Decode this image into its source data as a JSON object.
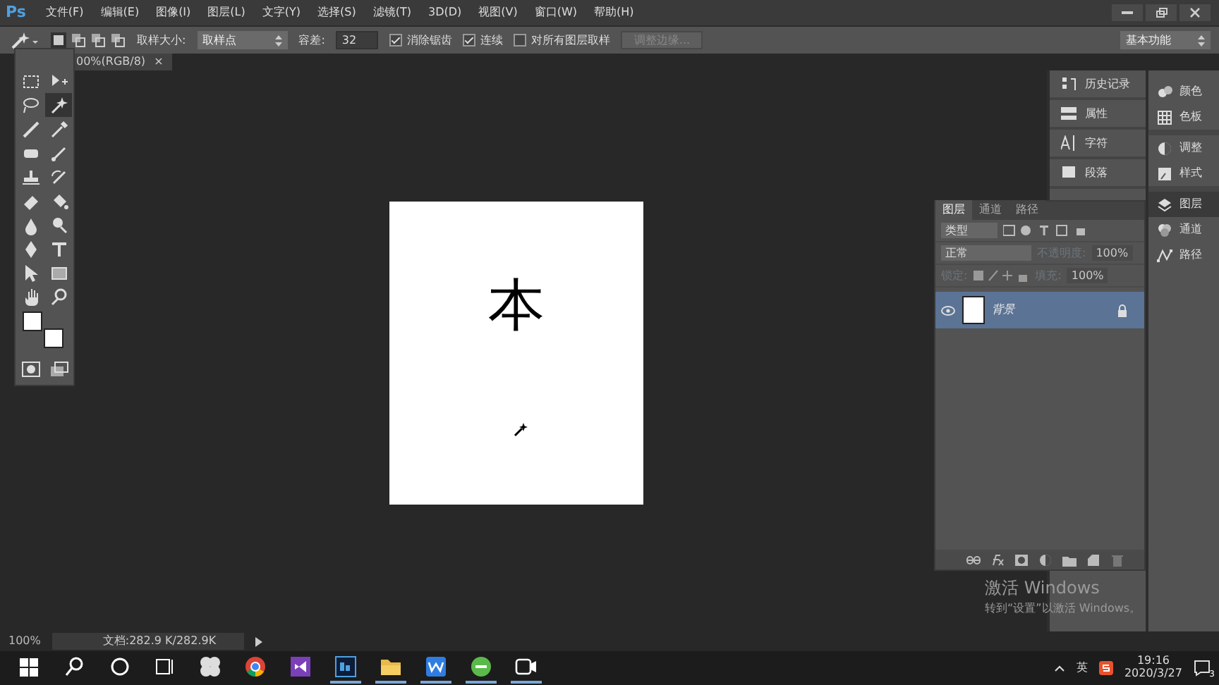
{
  "app_logo": "Ps",
  "menu": [
    "文件(F)",
    "编辑(E)",
    "图像(I)",
    "图层(L)",
    "文字(Y)",
    "选择(S)",
    "滤镜(T)",
    "3D(D)",
    "视图(V)",
    "窗口(W)",
    "帮助(H)"
  ],
  "options_bar": {
    "sample_size_label": "取样大小:",
    "sample_size_value": "取样点",
    "tolerance_label": "容差:",
    "tolerance_value": "32",
    "checkboxes": [
      {
        "label": "消除锯齿",
        "checked": true
      },
      {
        "label": "连续",
        "checked": true
      },
      {
        "label": "对所有图层取样",
        "checked": false
      }
    ],
    "refine_button": {
      "label": "调整边缘...",
      "disabled": true
    },
    "workspace": "基本功能"
  },
  "document_tab": {
    "title": "00%(RGB/8)",
    "close": "×"
  },
  "tools": [
    {
      "selected": false
    },
    {
      "selected": false
    },
    {
      "selected": false
    },
    {
      "selected": true
    },
    {
      "selected": false
    },
    {
      "selected": false
    },
    {
      "selected": false
    },
    {
      "selected": false
    },
    {
      "selected": false
    },
    {
      "selected": false
    },
    {
      "selected": false
    },
    {
      "selected": false
    },
    {
      "selected": false
    },
    {
      "selected": false
    },
    {
      "selected": false
    },
    {
      "selected": false
    },
    {
      "selected": false
    },
    {
      "selected": false
    },
    {
      "selected": false
    },
    {
      "selected": false
    }
  ],
  "canvas_text": "本",
  "panel_dock": [
    {
      "label": "历史记录"
    },
    {
      "label": "属性"
    },
    {
      "label": "字符"
    },
    {
      "label": "段落"
    }
  ],
  "icon_dock": [
    {
      "label": "颜色",
      "selected": false
    },
    {
      "label": "色板",
      "selected": false
    },
    {
      "label": "调整",
      "selected": false
    },
    {
      "label": "样式",
      "selected": false
    },
    {
      "label": "图层",
      "selected": true
    },
    {
      "label": "通道",
      "selected": false
    },
    {
      "label": "路径",
      "selected": false
    }
  ],
  "layers_panel": {
    "tabs": [
      {
        "label": "图层",
        "selected": true
      },
      {
        "label": "通道",
        "selected": false
      },
      {
        "label": "路径",
        "selected": false
      }
    ],
    "filter": "类型",
    "blend_mode": "正常",
    "opacity_label": "不透明度:",
    "opacity_value": "100%",
    "lock_label": "锁定:",
    "fill_label": "填充:",
    "fill_value": "100%",
    "layers": [
      {
        "name": "背景",
        "visible": true,
        "selected": true,
        "locked": true
      }
    ]
  },
  "status_bar": {
    "zoom": "100%",
    "doc_info": "文档:282.9 K/282.9K"
  },
  "activation": {
    "title": "激活 Windows",
    "subtitle": "转到“设置”以激活 Windows。"
  },
  "taskbar": {
    "apps": [
      {
        "running": false
      },
      {
        "running": false
      },
      {
        "running": false
      },
      {
        "running": true
      },
      {
        "running": true
      },
      {
        "running": true
      },
      {
        "running": true
      },
      {
        "running": true
      }
    ],
    "input_language": "英",
    "time": "19:16",
    "date": "2020/3/27",
    "notifications": "3"
  }
}
